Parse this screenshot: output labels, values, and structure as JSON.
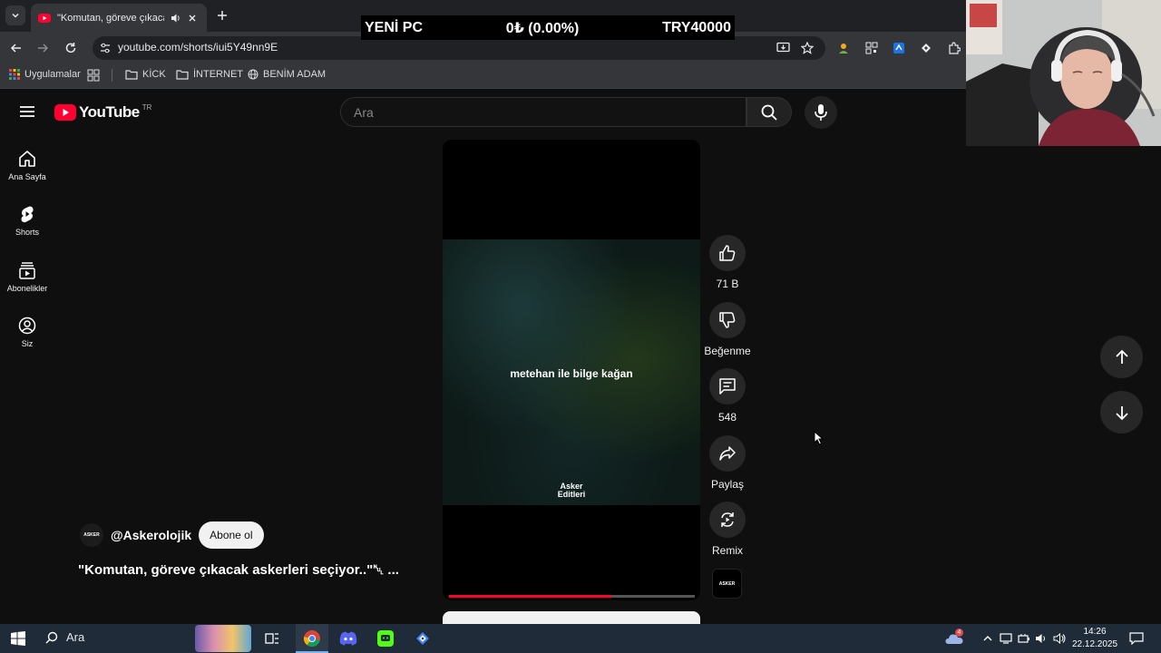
{
  "browser": {
    "tab_title": "\"Komutan, göreve çıkacak as",
    "url": "youtube.com/shorts/iui5Y49nn9E",
    "bookmarks": [
      "Uygulamalar",
      "KİCK",
      "İNTERNET",
      "BENİM ADAM"
    ]
  },
  "overlay": {
    "name": "YENİ PC",
    "change": "0₺ (0.00%)",
    "goal": "TRY40000"
  },
  "youtube": {
    "logo_text": "YouTube",
    "country_code": "TR",
    "search_placeholder": "Ara",
    "sidebar": [
      {
        "label": "Ana Sayfa",
        "icon": "home-icon"
      },
      {
        "label": "Shorts",
        "icon": "shorts-icon"
      },
      {
        "label": "Abonelikler",
        "icon": "subscriptions-icon"
      },
      {
        "label": "Siz",
        "icon": "account-icon"
      }
    ],
    "video": {
      "caption": "metehan ile bilge kağan",
      "watermark": "Asker\nEditleri",
      "progress": 0.66
    },
    "channel": {
      "handle": "@Askerolojik",
      "avatar_text": "ASKER",
      "subscribe_label": "Abone ol"
    },
    "title": "\"Komutan, göreve çıkacak askerleri seçiyor..\"␀ ...",
    "actions": {
      "likes": "71 B",
      "dislike": "Beğenme",
      "comments": "548",
      "share": "Paylaş",
      "remix": "Remix"
    }
  },
  "taskbar": {
    "search_label": "Ara",
    "time": "14:26",
    "date": "22.12.2025",
    "notification_count": "4"
  },
  "colors": {
    "yt_red": "#ff0033",
    "background": "#0f0f0f",
    "taskbar": "#1f2b38"
  }
}
